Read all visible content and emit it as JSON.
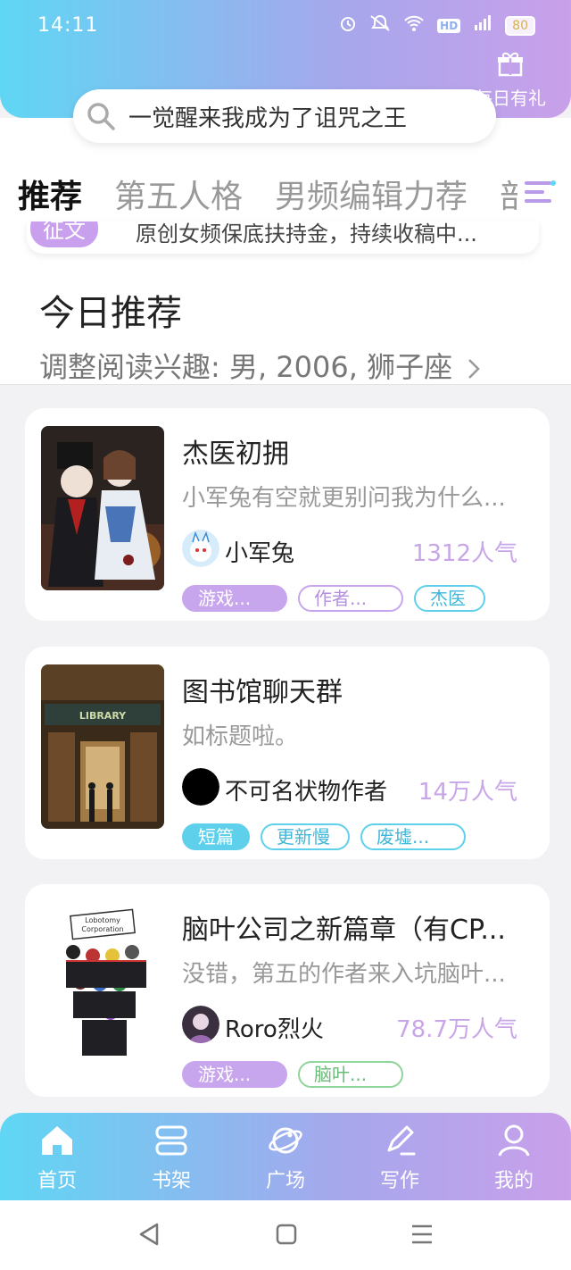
{
  "status_bar": {
    "time": "14:11",
    "battery": "80"
  },
  "header": {
    "gift_label": "每日有礼"
  },
  "search": {
    "placeholder_text": "一觉醒来我成为了诅咒之王"
  },
  "tabs": [
    {
      "label": "推荐",
      "active": true
    },
    {
      "label": "第五人格",
      "active": false
    },
    {
      "label": "男频编辑力荐",
      "active": false
    },
    {
      "label": "部",
      "active": false
    }
  ],
  "banner": {
    "badge": "征文",
    "text": "原创女频保底扶持金，持续收稿中..."
  },
  "section": {
    "title": "今日推荐",
    "subtitle": "调整阅读兴趣: 男, 2006, 狮子座"
  },
  "books": [
    {
      "title": "杰医初拥",
      "description": "小军兔有空就更别问我为什么...",
      "author": "小军兔",
      "popularity": "1312人气",
      "tags": [
        {
          "label": "游戏...",
          "style": "filled-purple"
        },
        {
          "label": "作者...",
          "style": "outline-purple"
        },
        {
          "label": "杰医",
          "style": "outline-cyan"
        }
      ]
    },
    {
      "title": "图书馆聊天群",
      "description": "如标题啦。",
      "author": "不可名状物作者",
      "popularity": "14万人气",
      "tags": [
        {
          "label": "短篇",
          "style": "filled-cyan"
        },
        {
          "label": "更新慢",
          "style": "outline-cyan"
        },
        {
          "label": "废墟...",
          "style": "outline-cyan"
        }
      ]
    },
    {
      "title": "脑叶公司之新篇章（有CP...",
      "description": "没错，第五的作者来入坑脑叶...",
      "author": "Roro烈火",
      "popularity": "78.7万人气",
      "tags": [
        {
          "label": "游戏...",
          "style": "filled-purple"
        },
        {
          "label": "脑叶...",
          "style": "outline-green"
        }
      ]
    }
  ],
  "bottom_nav": [
    {
      "label": "首页",
      "icon": "home-icon"
    },
    {
      "label": "书架",
      "icon": "bookshelf-icon"
    },
    {
      "label": "广场",
      "icon": "planet-icon"
    },
    {
      "label": "写作",
      "icon": "pen-icon"
    },
    {
      "label": "我的",
      "icon": "user-icon"
    }
  ],
  "colors": {
    "gradient_start": "#5fd6f4",
    "gradient_end": "#c9a0ea",
    "popularity": "#c8a6e8",
    "tag_purple": "#c8a6ee",
    "tag_cyan": "#5fd0ec",
    "tag_green": "#8fd49a"
  }
}
